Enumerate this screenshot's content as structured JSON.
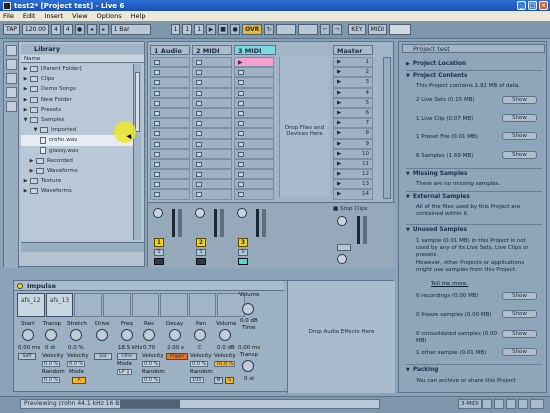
{
  "window": {
    "title": "test2* [Project test] - Live 6"
  },
  "menu": [
    "File",
    "Edit",
    "Insert",
    "View",
    "Options",
    "Help"
  ],
  "transport": {
    "tap": "TAP",
    "bpm": "120.00",
    "sig_num": "4",
    "sig_den": "4",
    "quant": "1 Bar",
    "ovr": "OVR",
    "key": "KEY",
    "midi": "MIDI",
    "pos": "1",
    "pos2": "1",
    "pos3": "1"
  },
  "browser": {
    "title": "Library",
    "header": "Name",
    "items": [
      {
        "label": "[Parent Folder]",
        "type": "folder",
        "tri": "▶"
      },
      {
        "label": "Clips",
        "type": "folder",
        "tri": "▶"
      },
      {
        "label": "Demo Songs",
        "type": "folder",
        "tri": "▶"
      },
      {
        "label": "New Folder",
        "type": "folder",
        "tri": "▶"
      },
      {
        "label": "Presets",
        "type": "folder",
        "tri": "▶"
      },
      {
        "label": "Samples",
        "type": "folder",
        "tri": "▼"
      },
      {
        "label": "Imported",
        "type": "folder",
        "tri": "▼"
      },
      {
        "label": "crohn.wav",
        "type": "file",
        "tri": ""
      },
      {
        "label": "glassy.wav",
        "type": "file",
        "tri": ""
      },
      {
        "label": "Recorded",
        "type": "folder",
        "tri": "▶"
      },
      {
        "label": "Waveforms",
        "type": "folder",
        "tri": "▶"
      },
      {
        "label": "Texture",
        "type": "folder",
        "tri": "▶"
      },
      {
        "label": "Waveforms",
        "type": "folder",
        "tri": "▶"
      }
    ]
  },
  "session": {
    "tracks": [
      "1 Audio",
      "2 MIDI",
      "3 MIDI"
    ],
    "master": "Master",
    "drop_text": "Drop Files and Devices Here",
    "scenes": [
      "1",
      "2",
      "3",
      "4",
      "5",
      "6",
      "7",
      "8",
      "9",
      "10",
      "11",
      "12",
      "13",
      "14"
    ],
    "track_numbers": [
      "1",
      "2",
      "3"
    ],
    "stop_clips": "Stop Clips",
    "solo": "S"
  },
  "info": {
    "title": "Project test",
    "sections": {
      "location": "Project Location",
      "contents": "Project Contents",
      "contents_text": "This Project contains 1.92 MB of data.",
      "live_sets": "2 Live Sets (0.15 MB)",
      "live_clip": "1 Live Clip (0.07 MB)",
      "preset_file": "1 Preset File (0.01 MB)",
      "samples": "6 Samples (1.69 MB)",
      "missing": "Missing Samples",
      "missing_text": "There are no missing samples.",
      "external": "External Samples",
      "external_text": "All of the files used by this Project are contained within it.",
      "unused": "Unused Samples",
      "unused_text1": "1 sample (0.01 MB) in this Project is not used by any of its Live Sets, Live Clips or presets.",
      "unused_text2": "However, other Projects or applications might use samples from this Project.",
      "tell_more": "Tell me more.",
      "rec_zero": "0 recordings (0.00 MB)",
      "freeze_zero": "0 freeze samples (0.00 MB)",
      "cons_zero": "0 consolidated samples (0.00 MB)",
      "other_one": "1 other sample (0.01 MB)",
      "packing": "Packing",
      "packing_text": "You can archive or share this Project"
    },
    "show_label": "Show"
  },
  "device": {
    "name": "Impulse",
    "pads": [
      "afs_12",
      "afs_13",
      "",
      "",
      "",
      "",
      "",
      ""
    ],
    "drop_text": "Drop Audio Effects Here",
    "ctrl": {
      "start": "Start",
      "transp": "Transp",
      "stretch": "Stretch",
      "drive": "Drive",
      "freq": "Freq",
      "res": "Res",
      "decay": "Decay",
      "pan": "Pan",
      "volume": "Volume",
      "time": "Time",
      "transp2": "Transp",
      "velocity": "Velocity",
      "random": "Random",
      "mode": "Mode",
      "filter": "Filter",
      "trigger": "Trigger",
      "soft": "Soft",
      "sat": "Sat"
    },
    "vals": {
      "start": "0.00 ms",
      "transp": "0 st",
      "stretch": "0.0 %",
      "freq": "18.5 kHz",
      "res": "0.70",
      "decay": "2.00 s",
      "pan": "C",
      "volume": "0.0 dB",
      "vel1": "0.0 %",
      "vel2": "0.0 %",
      "vel3": "0.0 %",
      "vel4": "0.0 %",
      "vel5": "70.0 %",
      "rand1": "0.0 %",
      "rand2": "0.0 %",
      "mode": "LP 1",
      "mval": "100",
      "time2": "0.00 ms",
      "tr2": "0 st",
      "mute": "M",
      "solo": "S"
    }
  },
  "status": {
    "message": "Previewing crohn 44.1 kHz 16 Bit Stereo",
    "midi": "3-MIDI"
  }
}
